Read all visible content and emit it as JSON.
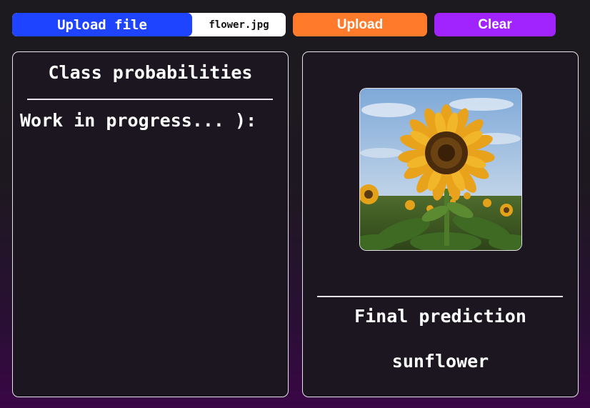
{
  "toolbar": {
    "upload_file_label": "Upload file",
    "file_name": "flower.jpg",
    "upload_label": "Upload",
    "clear_label": "Clear"
  },
  "left_panel": {
    "title": "Class probabilities",
    "status_text": "Work in progress... ):"
  },
  "right_panel": {
    "image_subject": "sunflower-photo",
    "final_title": "Final prediction",
    "prediction": "sunflower"
  },
  "colors": {
    "upload_file_button": "#1f44ff",
    "upload_button": "#ff7a2a",
    "clear_button": "#a124ff",
    "background_top": "#1c1a1e",
    "background_bottom": "#3a0646"
  }
}
